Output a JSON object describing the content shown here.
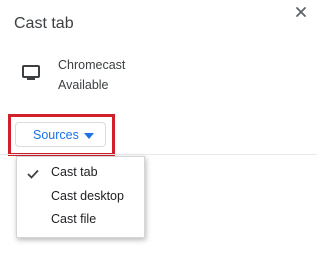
{
  "dialog": {
    "title": "Cast tab",
    "close_icon": "close-icon"
  },
  "sink": {
    "icon": "tv-icon",
    "name": "Chromecast",
    "status": "Available"
  },
  "sources": {
    "label": "Sources",
    "caret_icon": "caret-down-icon",
    "accent_color": "#1a73e8",
    "highlight_color": "#d0202a"
  },
  "menu": {
    "items": [
      {
        "label": "Cast tab",
        "checked": true
      },
      {
        "label": "Cast desktop",
        "checked": false
      },
      {
        "label": "Cast file",
        "checked": false
      }
    ]
  }
}
